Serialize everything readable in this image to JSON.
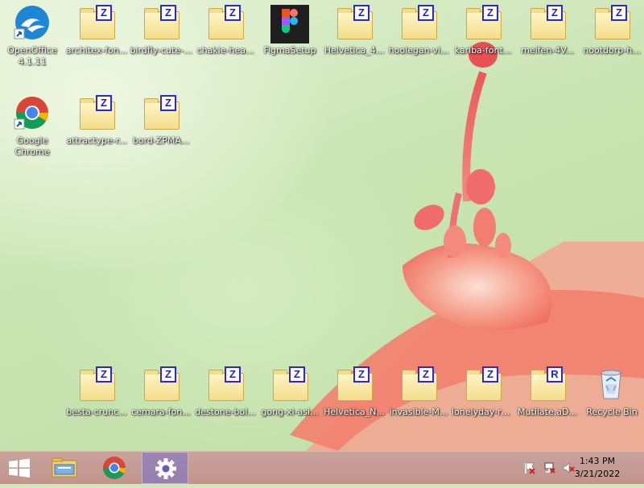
{
  "desktop": {
    "icons": {
      "openoffice": {
        "label": "OpenOffice 4.1.11"
      },
      "architex": {
        "label": "architex-fon..."
      },
      "birdfly": {
        "label": "birdfly-cute-..."
      },
      "chakie": {
        "label": "chakie-hea..."
      },
      "figma": {
        "label": "FigmaSetup"
      },
      "helvetica4": {
        "label": "Helvetica_4..."
      },
      "hoolegan": {
        "label": "hoolegan-vi..."
      },
      "kariba": {
        "label": "kariba-font..."
      },
      "meifen": {
        "label": "meifen-4V..."
      },
      "nootdorp": {
        "label": "nootdorp-h..."
      },
      "chrome": {
        "label": "Google Chrome"
      },
      "attractype": {
        "label": "attractype-r..."
      },
      "bord": {
        "label": "bord-ZPMA..."
      },
      "besta": {
        "label": "besta-crunc..."
      },
      "cemara": {
        "label": "cemara-fon..."
      },
      "destone": {
        "label": "destone-bol..."
      },
      "gongxi": {
        "label": "gong-xi-asi..."
      },
      "helveticaN": {
        "label": "Helvetica_N..."
      },
      "invasible": {
        "label": "invasible-M..."
      },
      "lonelyday": {
        "label": "lonelyday-ro..."
      },
      "mutilate": {
        "label": "Mutilate.aD..."
      },
      "recycle": {
        "label": "Recycle Bin"
      }
    }
  },
  "taskbar": {
    "clock": {
      "time": "1:43 PM",
      "date": "3/21/2022"
    },
    "pinned": [
      "start-button",
      "file-explorer",
      "google-chrome",
      "settings"
    ]
  },
  "colors": {
    "archive_badge": "#2a2ad0",
    "taskbar": "#c49c92",
    "active_task": "#7a6ec8"
  }
}
